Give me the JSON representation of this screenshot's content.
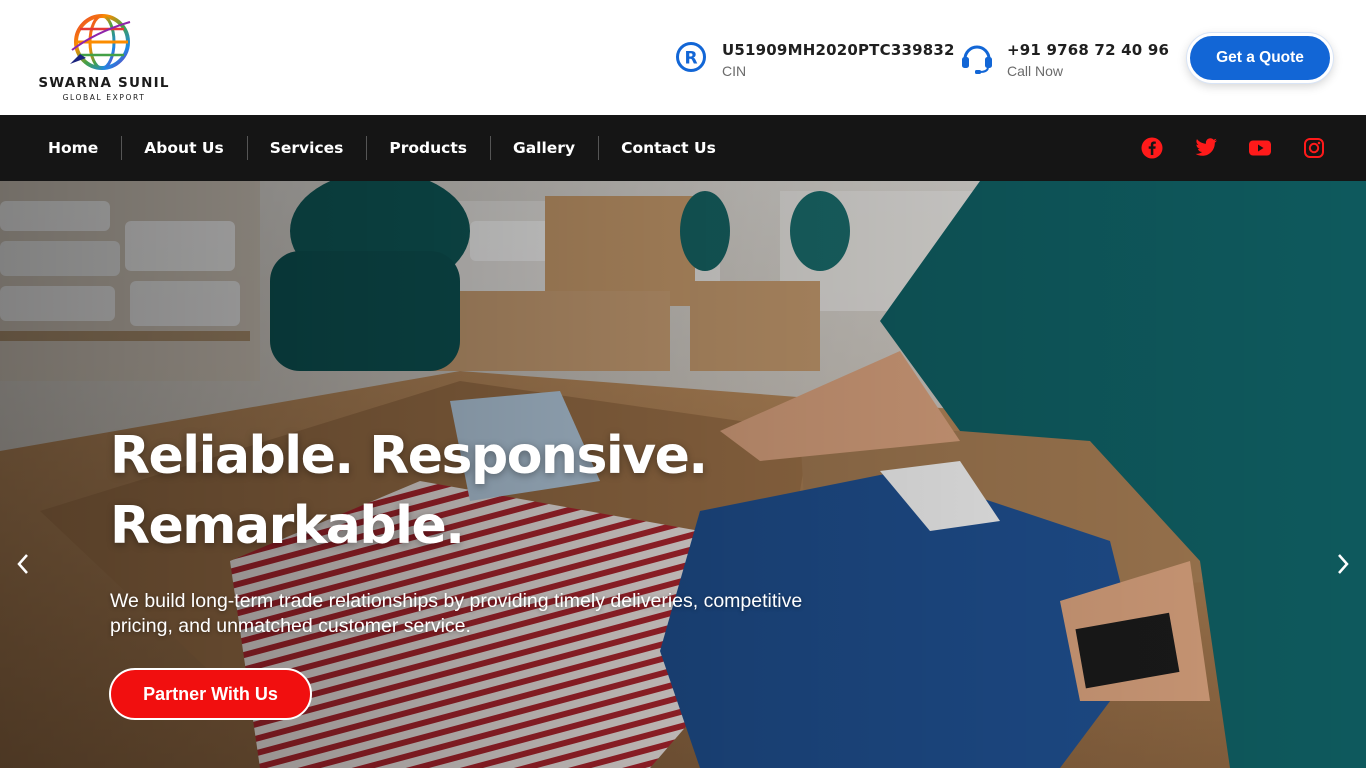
{
  "brand": {
    "name": "SWARNA SUNIL",
    "tagline": "GLOBAL EXPORT"
  },
  "header": {
    "cin": {
      "value": "U51909MH2020PTC339832",
      "label": "CIN",
      "icon": "registered-icon"
    },
    "phone": {
      "value": "+91 9768 72 40 96",
      "label": "Call Now",
      "icon": "headset-icon"
    },
    "quote_button": "Get a Quote"
  },
  "nav": {
    "items": [
      {
        "label": "Home"
      },
      {
        "label": "About Us"
      },
      {
        "label": "Services"
      },
      {
        "label": "Products"
      },
      {
        "label": "Gallery"
      },
      {
        "label": "Contact Us"
      }
    ],
    "socials": [
      "facebook-icon",
      "twitter-icon",
      "youtube-icon",
      "instagram-icon"
    ]
  },
  "hero": {
    "title_line1": "Reliable. Responsive.",
    "title_line2": "Remarkable.",
    "description": "We build long-term trade relationships by providing timely deliveries, competitive pricing, and unmatched customer service.",
    "cta": "Partner With Us"
  },
  "colors": {
    "accent_blue": "#1266d6",
    "accent_red": "#f10f0f",
    "nav_bg": "#151515",
    "social_red": "#ff1a1a"
  }
}
